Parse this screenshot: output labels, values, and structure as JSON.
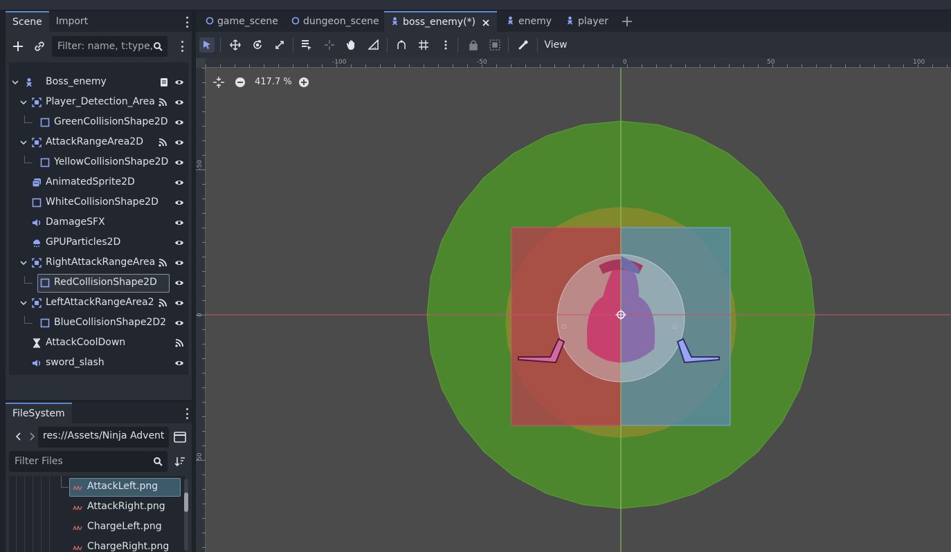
{
  "scene_dock": {
    "tabs": [
      "Scene",
      "Import"
    ],
    "filter_placeholder": "Filter: name, t:type,",
    "nodes": [
      {
        "name": "Boss_enemy",
        "icon": "character-body-icon"
      },
      {
        "name": "Player_Detection_Area",
        "icon": "area2d-icon"
      },
      {
        "name": "GreenCollisionShape2D",
        "icon": "collision-shape-icon"
      },
      {
        "name": "AttackRangeArea2D",
        "icon": "area2d-icon"
      },
      {
        "name": "YellowCollisionShape2D",
        "icon": "collision-shape-icon"
      },
      {
        "name": "AnimatedSprite2D",
        "icon": "animated-sprite-icon"
      },
      {
        "name": "WhiteCollisionShape2D",
        "icon": "collision-shape-icon"
      },
      {
        "name": "DamageSFX",
        "icon": "audio-icon"
      },
      {
        "name": "GPUParticles2D",
        "icon": "particles-icon"
      },
      {
        "name": "RightAttackRangeArea",
        "icon": "area2d-icon"
      },
      {
        "name": "RedCollisionShape2D",
        "icon": "collision-shape-icon"
      },
      {
        "name": "LeftAttackRangeArea2",
        "icon": "area2d-icon"
      },
      {
        "name": "BlueCollisionShape2D2",
        "icon": "collision-shape-icon"
      },
      {
        "name": "AttackCoolDown",
        "icon": "timer-icon"
      },
      {
        "name": "sword_slash",
        "icon": "audio-icon"
      }
    ]
  },
  "filesystem": {
    "tab": "FileSystem",
    "path": "res://Assets/Ninja Advent",
    "filter_placeholder": "Filter Files",
    "files": [
      "AttackLeft.png",
      "AttackRight.png",
      "ChargeLeft.png",
      "ChargeRight.png"
    ]
  },
  "scene_tabs": [
    "game_scene",
    "dungeon_scene",
    "boss_enemy(*)",
    "enemy",
    "player"
  ],
  "toolbar": {
    "view_label": "View"
  },
  "viewport": {
    "zoom": "417.7 %",
    "ruler_top_labels": [
      "-100",
      "-50",
      "0",
      "50",
      "100"
    ],
    "ruler_left_labels": [
      "-50",
      "0",
      "50"
    ]
  },
  "colors": {
    "accent": "#5d8ad6",
    "icon_blue": "#8da5f3",
    "green_area": "#4c8c2b",
    "yellow_area": "#8a8a2a",
    "red_area": "#a0404e",
    "blue_area": "#5b8aa8"
  }
}
